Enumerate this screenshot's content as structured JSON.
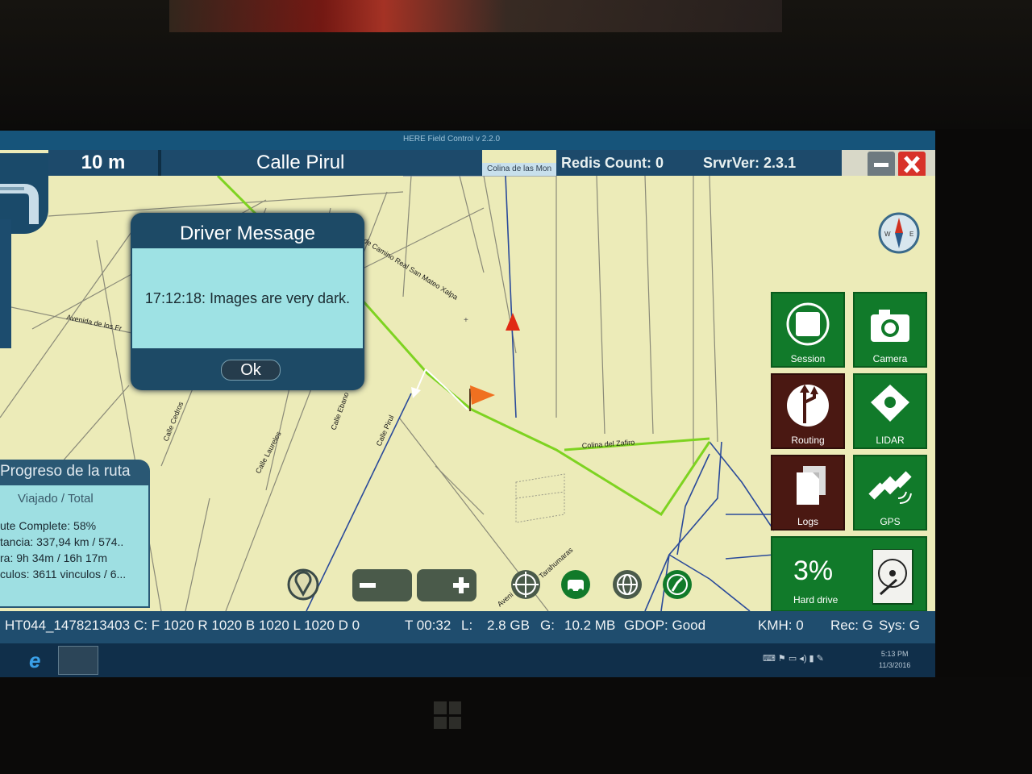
{
  "window": {
    "title": "HERE Field Control v 2.2.0"
  },
  "header": {
    "distance": "10 m",
    "street": "Calle Pirul",
    "cross_street": "Colina de las Mon",
    "redis": "Redis Count: 0",
    "server": "SrvrVer: 2.3.1"
  },
  "dialog": {
    "title": "Driver Message",
    "message": "17:12:18: Images are very dark.",
    "ok_label": "Ok"
  },
  "map_labels": {
    "avenida": "Avenida de los Fr",
    "camino": "de Camino Real San Mateo Xalpa",
    "cedros": "Calle Cedros",
    "laureles": "Calle Laureles",
    "ebano": "Calle Ebano",
    "pirul": "Calle Pirul",
    "zafiro": "Colina del Zafiro",
    "tarahumaras": "Tarahumaras",
    "avenida2": "Aveni"
  },
  "tiles": {
    "session": "Session",
    "camera": "Camera",
    "routing": "Routing",
    "lidar": "LIDAR",
    "logs": "Logs",
    "gps": "GPS",
    "hard_drive": {
      "value": "3%",
      "label": "Hard drive"
    }
  },
  "progress": {
    "title": "Progreso de la ruta",
    "subtitle": "Viajado / Total",
    "complete": "ute Complete: 58%",
    "distance": "tancia: 337,94 km / 574..",
    "time": "ra: 9h 34m / 16h 17m",
    "links": "culos: 3611 vinculos / 6..."
  },
  "status": {
    "session_id": "HT044_1478213403",
    "cameras": "C: F 1020 R 1020 B 1020 L 1020 D 0",
    "time": "T 00:32",
    "l_label": "L:",
    "l_value": "2.8 GB",
    "g_label": "G:",
    "g_value": "10.2 MB",
    "gdop": "GDOP: Good",
    "kmh": "KMH: 0",
    "rec": "Rec: G",
    "sys": "Sys: G"
  },
  "taskbar": {
    "time": "5:13 PM",
    "date": "11/3/2016"
  },
  "colors": {
    "route": "#7ed321",
    "header": "#1d4a6b",
    "tile_green": "#117a2a",
    "tile_brown": "#4a1812",
    "map_bg": "#ecebb8"
  }
}
